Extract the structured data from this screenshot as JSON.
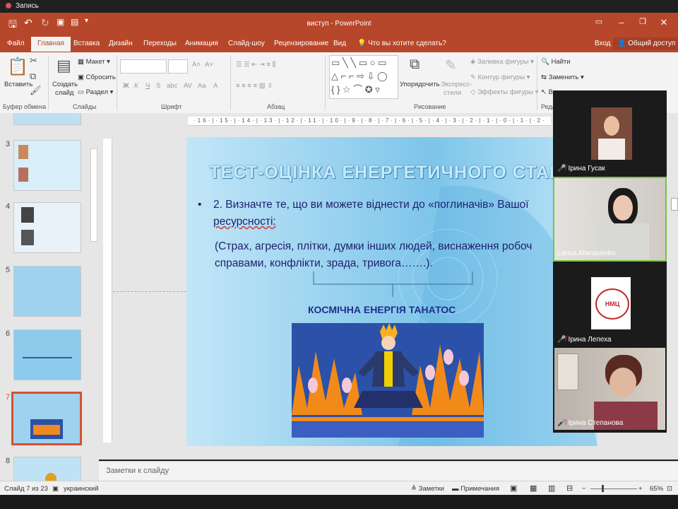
{
  "recording": {
    "label": "Запись"
  },
  "titlebar": {
    "title": "виступ - PowerPoint"
  },
  "tabs": [
    "Файл",
    "Главная",
    "Вставка",
    "Дизайн",
    "Переходы",
    "Анимация",
    "Слайд-шоу",
    "Рецензирование",
    "Вид"
  ],
  "tell_me": "Что вы хотите сделать?",
  "account": {
    "login": "Вход",
    "share": "Общий доступ"
  },
  "ribbon": {
    "paste": "Вставить",
    "new_slide_1": "Создать",
    "new_slide_2": "слайд",
    "layout": "Макет",
    "reset": "Сбросить",
    "section": "Раздел",
    "arrange": "Упорядочить",
    "quick_styles_1": "Экспресс-",
    "quick_styles_2": "стили",
    "shape_fill": "Заливка фигуры",
    "shape_outline": "Контур фигуры",
    "shape_effects": "Эффекты фигуры",
    "find": "Найти",
    "replace": "Заменить",
    "bold": "Ж",
    "italic": "К",
    "underline": "Ч",
    "strike": "S",
    "groups": {
      "clipboard": "Буфер обмена",
      "slides": "Слайды",
      "font": "Шрифт",
      "paragraph": "Абзац",
      "drawing": "Рисование",
      "editing": "Реда"
    }
  },
  "thumbnails": [
    {
      "num": "3"
    },
    {
      "num": "4"
    },
    {
      "num": "5"
    },
    {
      "num": "6"
    },
    {
      "num": "7"
    },
    {
      "num": "8"
    }
  ],
  "slide": {
    "title": "ТЕСТ-ОЦІНКА ЕНЕРГЕТИЧНОГО СТАНУ",
    "bullet_line1": "2. Визначте те, що ви можете віднести до «поглиначів» Вашої",
    "bullet_line2": "ресурсності:",
    "para_line1": "(Страх, агресія, плітки, думки інших людей, виснаження робоч",
    "para_line2": "справами, конфлікти, зрада, тривога…….).",
    "subtitle": "КОСМІЧНА ЕНЕРГІЯ ТАНАТОС"
  },
  "notes": {
    "placeholder": "Заметки к слайду"
  },
  "status": {
    "slide": "Слайд 7 из 23",
    "language": "украинский",
    "notes": "Заметки",
    "comments": "Примечания",
    "zoom": "65%"
  },
  "participants": [
    {
      "name": "Ірина Гусак"
    },
    {
      "name": "Larisa Afanasenko"
    },
    {
      "name": "Ірина Лепеха"
    },
    {
      "name": "Ірина Степанова"
    }
  ],
  "colors": {
    "accent": "#b7472a",
    "active_thumb": "#d35230",
    "mic_muted": "#e0413d"
  }
}
